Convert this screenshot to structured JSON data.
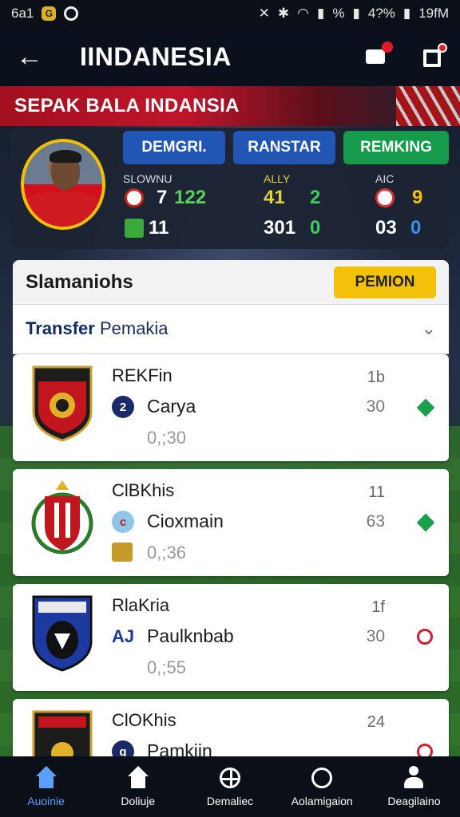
{
  "status_bar": {
    "left_text": "6a1",
    "right_signal": "%",
    "battery": "4?%",
    "time": "19fM"
  },
  "app_bar": {
    "title": "IINDANESIA"
  },
  "banner": {
    "text": "SEPAK BALA INDANSIA"
  },
  "profile": {
    "tabs": [
      "DEMGRI.",
      "RANSTAR",
      "REMKING"
    ],
    "stats": {
      "col1": {
        "label": "SLOWNU",
        "a": "7",
        "b": "122",
        "c": "11"
      },
      "col2": {
        "label": "ALLY",
        "a": "41",
        "b": "2",
        "c": "301",
        "d": "0"
      },
      "col3": {
        "label": "AIC",
        "a": "9",
        "c": "03",
        "d": "0"
      }
    }
  },
  "main_card": {
    "title": "Slamaniohs",
    "premium_label": "PEMION",
    "section_title_a": "Transfer",
    "section_title_b": "Pemakia"
  },
  "clubs": [
    {
      "name": "REKFin",
      "top_num": "1b",
      "player": "Carya",
      "player_num": "30",
      "time": "0,;30",
      "player_icon": "2",
      "status": "up"
    },
    {
      "name": "ClBKhis",
      "top_num": "11",
      "player": "Cioxmain",
      "player_num": "63",
      "time": "0,;36",
      "player_icon": "c",
      "status": "up"
    },
    {
      "name": "RlaKria",
      "top_num": "1f",
      "player": "Paulknbab",
      "player_num": "30",
      "time": "0,;55",
      "player_icon": "AJ",
      "status": "down"
    },
    {
      "name": "ClOKhis",
      "top_num": "24",
      "player": "Pamkiin",
      "player_num": "",
      "time": "",
      "player_icon": "g",
      "status": "down"
    }
  ],
  "bottom_nav": [
    {
      "label": "Auoinie",
      "icon": "home-icon",
      "active": true
    },
    {
      "label": "Doliuje",
      "icon": "home-icon",
      "active": false
    },
    {
      "label": "Demaliec",
      "icon": "grid-icon",
      "active": false
    },
    {
      "label": "Aolamigaion",
      "icon": "clock-icon",
      "active": false
    },
    {
      "label": "Deagilaino",
      "icon": "user-icon",
      "active": false
    }
  ],
  "colors": {
    "accent_blue": "#2156b4",
    "accent_green": "#169a4b",
    "premium_yellow": "#f3c00a",
    "banner_red": "#c0152a"
  }
}
